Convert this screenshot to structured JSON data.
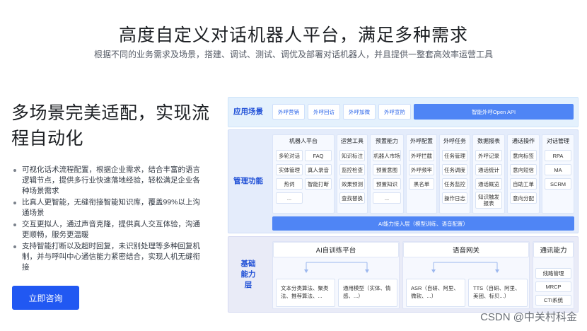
{
  "hero": {
    "title": "高度自定义对话机器人平台，满足多种需求",
    "subtitle": "根据不同的业务需求及场景，搭建、调试、测试、调优及部署对话机器人，并且提供一整套高效率运营工具"
  },
  "feature": {
    "title": "多场景完美适配，实现流程自动化",
    "bullets": [
      "可视化话术流程配置，根据企业需求，结合丰富的语言逻辑节点，提供多行业快速落地经验，轻松满足企业各种场景需求",
      "比真人更智能，无缝衔接智能知识库，覆盖99%以上沟通场景",
      "交互更拟人，通过声音克隆，提供真人交互体验，沟通更顺畅，服务更温暖",
      "支持智能打断以及超时回复，未识别处理等多种回复机制，并与呼叫中心通信能力紧密结合，实现人机无缝衔接"
    ],
    "cta_label": "立即咨询"
  },
  "arch": {
    "scenario": {
      "label": "应用场景",
      "items": [
        "外呼营销",
        "外呼回访",
        "外呼加微",
        "外呼宣防"
      ],
      "open_api": "智能外呼Open API"
    },
    "management": {
      "label": "管理功能",
      "columns": [
        {
          "title": "机器人平台",
          "cells": [
            "多轮对话",
            "FAQ",
            "实体管理",
            "真人录音",
            "热词",
            "智能打断",
            "..."
          ]
        },
        {
          "title": "运营工具",
          "cells": [
            "知识标注",
            "监控检查",
            "效果预测",
            "查找替换"
          ]
        },
        {
          "title": "预置能力",
          "cells": [
            "机器人市场",
            "预置意图",
            "预置知识",
            "..."
          ]
        },
        {
          "title": "外呼配置",
          "cells": [
            "外呼拦截",
            "外呼频率",
            "黑名单"
          ]
        },
        {
          "title": "外呼任务",
          "cells": [
            "任务管理",
            "任务调度",
            "任务监控",
            "操作日志"
          ]
        },
        {
          "title": "数据报表",
          "cells": [
            "外呼记录",
            "通话统计",
            "通话概览",
            "知识触发报表"
          ]
        },
        {
          "title": "通话操作",
          "cells": [
            "意向标签",
            "意向短信",
            "自助工单",
            "意向分配"
          ]
        },
        {
          "title": "对话管理",
          "cells": [
            "RPA",
            "MA",
            "SCRM"
          ]
        }
      ],
      "access_layer": "AI能力接入层（模型训练、语音配置）"
    },
    "base": {
      "label": "基础能力层",
      "ai_training": {
        "title": "AI自训练平台",
        "cards": [
          "文本分类算法、聚类法、推荐算法、...",
          "通用模型（实体、情感、...）"
        ]
      },
      "voice_gateway": {
        "title": "语音网关",
        "cards": [
          "ASR（自研、阿里、微软、...）",
          "TTS（自研、阿里、美团、标贝...）"
        ]
      },
      "comm": {
        "title": "通讯能力",
        "items": [
          "线路管理",
          "MRCP",
          "CTI系统"
        ]
      }
    }
  },
  "watermark": "CSDN @中关村科金"
}
